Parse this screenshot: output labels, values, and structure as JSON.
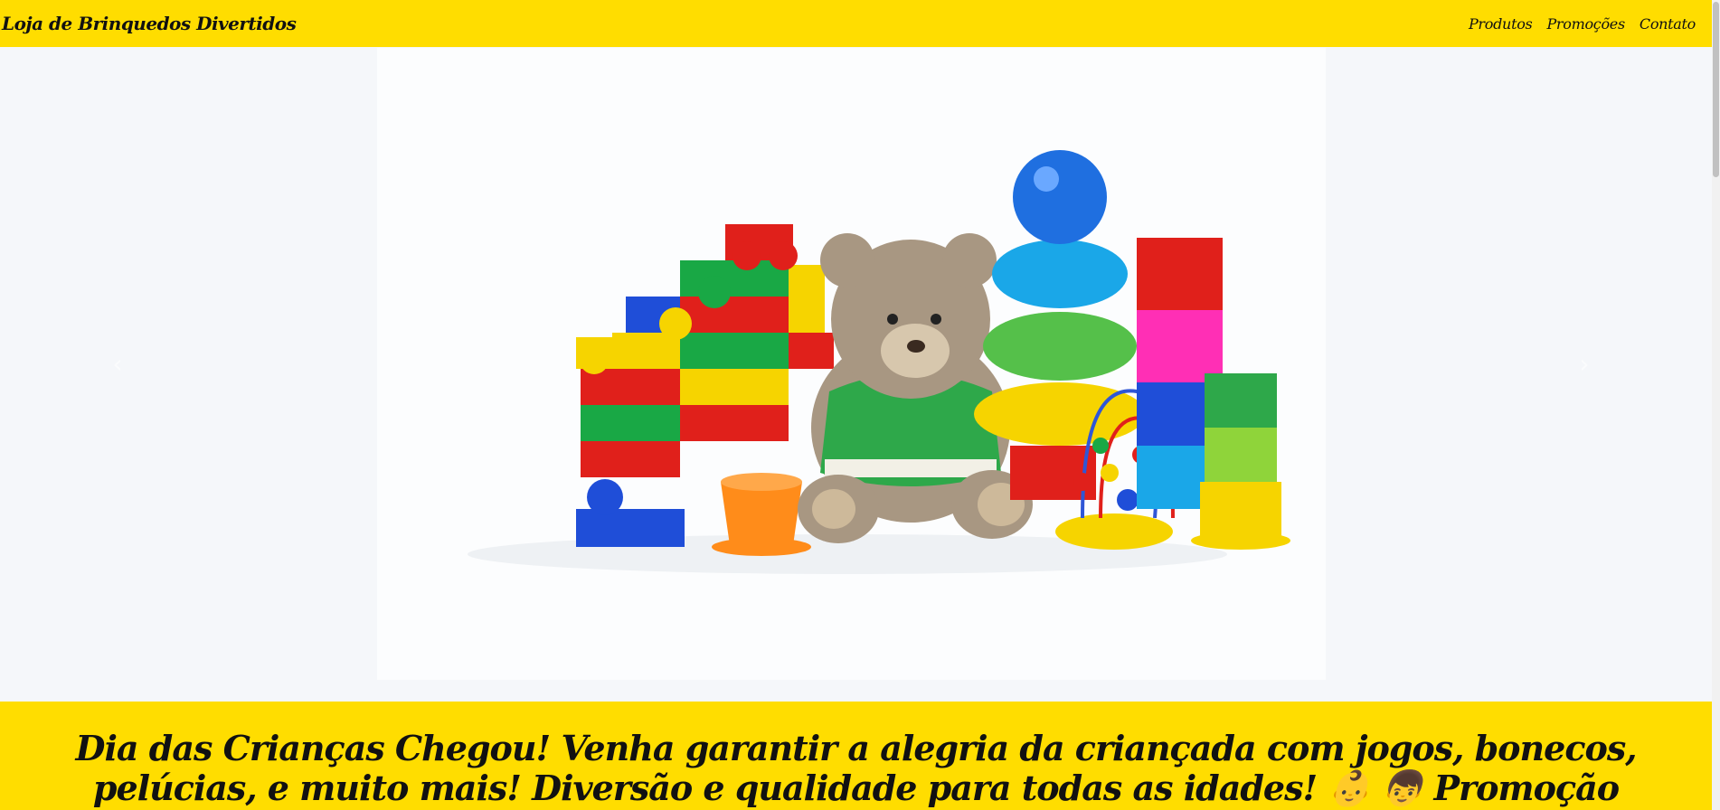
{
  "navbar": {
    "brand": "Loja de Brinquedos Divertidos",
    "links": [
      {
        "label": "Produtos"
      },
      {
        "label": "Promoções"
      },
      {
        "label": "Contato"
      }
    ]
  },
  "carousel": {
    "prev_icon": "‹",
    "next_icon": "›",
    "slide_description_icon": "toys-photo"
  },
  "promo": {
    "text": "Dia das Crianças Chegou! Venha garantir a alegria da criançada com jogos, bonecos, pelúcias, e muito mais! Diversão e qualidade para todas as idades! 👶 👦 Promoção válida até o Dia das Crianças."
  },
  "colors": {
    "brand_yellow": "#ffdd00"
  }
}
